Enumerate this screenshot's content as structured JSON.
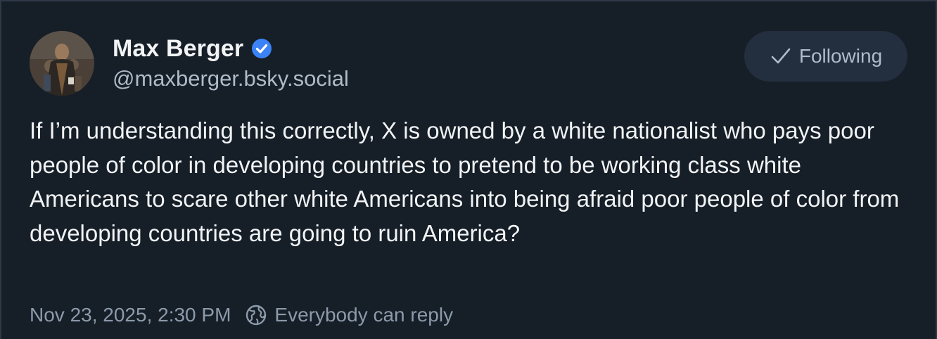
{
  "post": {
    "author": {
      "display_name": "Max Berger",
      "handle": "@maxberger.bsky.social",
      "verified": true,
      "avatar_icon": "avatar-photo"
    },
    "follow_button": {
      "label": "Following",
      "icon": "check-icon"
    },
    "text": "If I’m understanding this correctly, X is owned by a white nationalist who pays poor people of color in developing countries to pretend to be working class white Americans to scare other white Americans into being afraid poor people of color from developing countries are going to ruin America?",
    "timestamp": "Nov 23, 2025, 2:30 PM",
    "reply_setting": {
      "icon": "globe-icon",
      "label": "Everybody can reply"
    }
  },
  "colors": {
    "background": "#161e27",
    "text_primary": "#f1f3f5",
    "text_secondary": "#aebbc9",
    "text_muted": "#8c9aab",
    "button_bg": "#232e3e",
    "verified_badge": "#3b82f6"
  }
}
